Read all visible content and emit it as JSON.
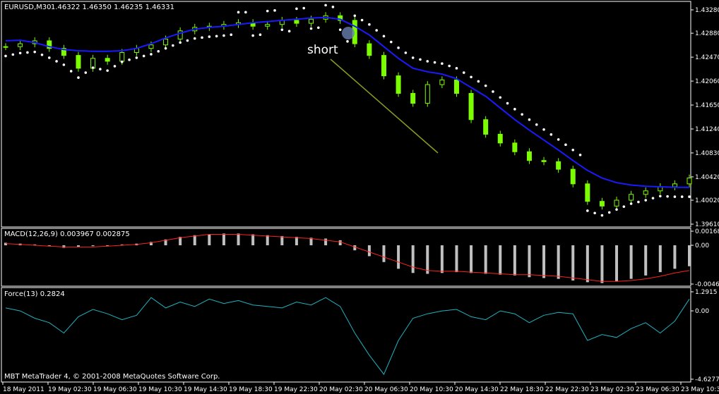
{
  "header": {
    "symbol": "EURUSD,M30",
    "ohlc": "1.46322 1.46350 1.46235 1.46331"
  },
  "annotation": {
    "text": "short"
  },
  "colors": {
    "bg": "#000000",
    "grid_border": "#ffffff",
    "candle": "#7CFC00",
    "ma": "#1a1aff",
    "sar": "#ffffff",
    "macd_hist": "#c0c0c0",
    "macd_signal": "#ff2020",
    "force": "#20b2c0",
    "trendline": "#8a9a20"
  },
  "panels": {
    "main": {
      "yticks": [
        "1.43280",
        "1.42880",
        "1.42470",
        "1.42060",
        "1.41650",
        "1.41240",
        "1.40830",
        "1.40420",
        "1.40020",
        "1.39610"
      ]
    },
    "macd": {
      "label": "MACD(12,26,9) 0.003967 0.002875",
      "yticks": [
        "0.00168",
        "0.00",
        "-0.00462"
      ]
    },
    "force": {
      "label": "Force(13) 0.2824",
      "yticks": [
        "1.2915",
        "0.00",
        "-4.6277"
      ]
    }
  },
  "copyright": "MBT MetaTrader 4, © 2001-2008 MetaQuotes Software Corp.",
  "xticks": [
    "18 May 2011",
    "19 May 02:30",
    "19 May 06:30",
    "19 May 10:30",
    "19 May 14:30",
    "19 May 18:30",
    "19 May 22:30",
    "20 May 02:30",
    "20 May 06:30",
    "20 May 10:30",
    "20 May 14:30",
    "22 May 18:30",
    "22 May 22:30",
    "23 May 02:30",
    "23 May 06:30",
    "23 May 10:30"
  ],
  "chart_data": [
    {
      "type": "line",
      "title": "EURUSD,M30",
      "ylim": [
        1.3961,
        1.4328
      ],
      "series": [
        {
          "name": "",
          "values": [
            1.4265,
            1.427,
            1.4275,
            1.4262,
            1.425,
            1.4228,
            1.4245,
            1.424,
            1.4255,
            1.4262,
            1.4268,
            1.4278,
            1.4292,
            1.4298,
            1.43,
            1.4303,
            1.4306,
            1.43,
            1.4303,
            1.431,
            1.4305,
            1.4312,
            1.4318,
            1.431,
            1.427,
            1.425,
            1.4215,
            1.4185,
            1.4168,
            1.42,
            1.4208,
            1.4185,
            1.414,
            1.4115,
            1.41,
            1.4085,
            1.407,
            1.4068,
            1.4055,
            1.403,
            1.4,
            1.3992,
            1.4002,
            1.4012,
            1.4018,
            1.4025,
            1.403,
            1.404
          ]
        },
        {
          "name": "",
          "values": [
            1.4275,
            1.4276,
            1.4272,
            1.4265,
            1.426,
            1.4258,
            1.4257,
            1.4257,
            1.4258,
            1.4262,
            1.427,
            1.428,
            1.4288,
            1.4295,
            1.4298,
            1.43,
            1.4303,
            1.4306,
            1.4308,
            1.431,
            1.4312,
            1.4314,
            1.4315,
            1.4312,
            1.43,
            1.4285,
            1.4265,
            1.4245,
            1.4228,
            1.4222,
            1.4218,
            1.421,
            1.4195,
            1.418,
            1.416,
            1.414,
            1.4122,
            1.4105,
            1.4088,
            1.407,
            1.4053,
            1.404,
            1.4032,
            1.4028,
            1.4026,
            1.4025,
            1.4024,
            1.4024
          ]
        }
      ]
    },
    {
      "type": "bar",
      "title": "MACD(12,26,9) 0.003967 0.002875",
      "ylim": [
        -0.00462,
        0.00168
      ],
      "series": [
        {
          "name": "",
          "values": [
            0.0003,
            0.0002,
            0.0001,
            -0.0001,
            -0.0003,
            -0.0002,
            -0.0001,
            0.0,
            0.0001,
            0.0002,
            0.0004,
            0.0007,
            0.001,
            0.0012,
            0.0013,
            0.0014,
            0.0014,
            0.0013,
            0.0012,
            0.0011,
            0.001,
            0.0009,
            0.0008,
            0.0006,
            -0.0006,
            -0.0013,
            -0.002,
            -0.0028,
            -0.0033,
            -0.0034,
            -0.0033,
            -0.0032,
            -0.0033,
            -0.0034,
            -0.0035,
            -0.0036,
            -0.0038,
            -0.0039,
            -0.004,
            -0.0042,
            -0.0044,
            -0.0045,
            -0.0043,
            -0.004,
            -0.0036,
            -0.0032,
            -0.0028,
            -0.0025
          ]
        },
        {
          "name": "",
          "values": [
            0.0002,
            0.0001,
            0.0,
            -0.0001,
            -0.0002,
            -0.0002,
            -0.0002,
            -0.0001,
            0.0,
            0.0001,
            0.0003,
            0.0006,
            0.0009,
            0.0011,
            0.0013,
            0.0013,
            0.0013,
            0.0012,
            0.0011,
            0.001,
            0.0009,
            0.0008,
            0.0006,
            0.0004,
            -0.0002,
            -0.0008,
            -0.0014,
            -0.002,
            -0.0026,
            -0.003,
            -0.0031,
            -0.0031,
            -0.0032,
            -0.0033,
            -0.0034,
            -0.0035,
            -0.0035,
            -0.0036,
            -0.0037,
            -0.0039,
            -0.0041,
            -0.0043,
            -0.0043,
            -0.0042,
            -0.004,
            -0.0037,
            -0.0033,
            -0.003
          ]
        }
      ]
    },
    {
      "type": "line",
      "title": "Force(13) 0.2824",
      "ylim": [
        -4.6277,
        1.2915
      ],
      "series": [
        {
          "name": "",
          "values": [
            0.2,
            0.0,
            -0.5,
            -0.8,
            -1.5,
            -0.4,
            0.1,
            -0.2,
            -0.6,
            -0.3,
            0.9,
            0.2,
            0.6,
            0.3,
            0.8,
            0.5,
            0.7,
            0.4,
            0.3,
            0.2,
            0.6,
            0.4,
            0.9,
            0.3,
            -1.5,
            -3.0,
            -4.3,
            -2.0,
            -0.5,
            -0.2,
            0.0,
            0.1,
            -0.4,
            -0.6,
            0.0,
            -0.2,
            -0.8,
            -0.3,
            -0.1,
            -0.2,
            -2.0,
            -1.6,
            -1.8,
            -1.2,
            -0.8,
            -1.5,
            -0.7,
            0.8
          ]
        }
      ]
    }
  ]
}
